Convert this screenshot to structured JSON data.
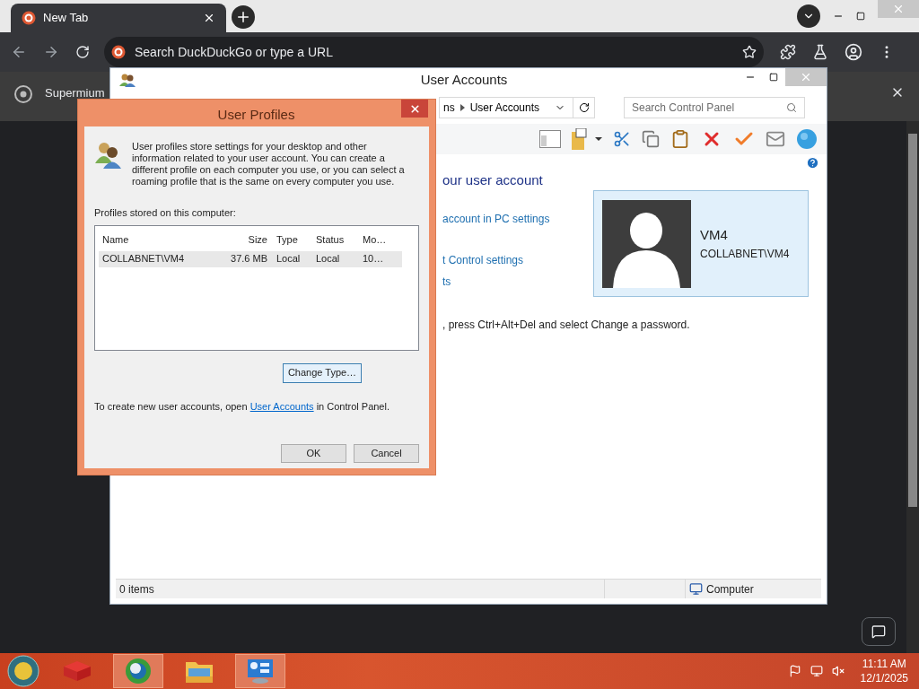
{
  "browser": {
    "tabs": [
      {
        "title": "New Tab",
        "selected": true
      }
    ],
    "address_placeholder": "Search DuckDuckGo or type a URL",
    "infobar": "Supermium"
  },
  "user_accounts": {
    "title": "User Accounts",
    "breadcrumb": [
      "ns",
      "User Accounts"
    ],
    "search_placeholder": "Search Control Panel",
    "heading": "our user account",
    "links": [
      "account in PC settings",
      "t Control settings",
      "ts"
    ],
    "note": ", press Ctrl+Alt+Del and select Change a password.",
    "account": {
      "name": "VM4",
      "domain": "COLLABNET\\VM4"
    },
    "status_bar": {
      "items": "0 items",
      "location": "Computer"
    }
  },
  "user_profiles": {
    "title": "User Profiles",
    "description": "User profiles store settings for your desktop and other information related to your user account. You can create a different profile on each computer you use, or you can select a roaming profile that is the same on every computer you use.",
    "list_label": "Profiles stored on this computer:",
    "columns": [
      "Name",
      "Size",
      "Type",
      "Status",
      "Mo…"
    ],
    "rows": [
      {
        "cells": [
          "COLLABNET\\VM4",
          "37.6 MB",
          "Local",
          "Local",
          "10…"
        ],
        "selected": true
      }
    ],
    "change_type": "Change Type…",
    "footer": {
      "before": "To create new user accounts, open",
      "link": "User Accounts",
      "after": "in Control Panel."
    },
    "buttons": [
      "OK",
      "Cancel"
    ]
  },
  "taskbar": {
    "apps": [
      {
        "kind": "bag",
        "selected": false
      },
      {
        "kind": "browser",
        "selected": true
      },
      {
        "kind": "folder",
        "selected": false
      },
      {
        "kind": "control-panel",
        "selected": true
      }
    ],
    "time": "11:11 AM",
    "date": "12/1/2025"
  }
}
